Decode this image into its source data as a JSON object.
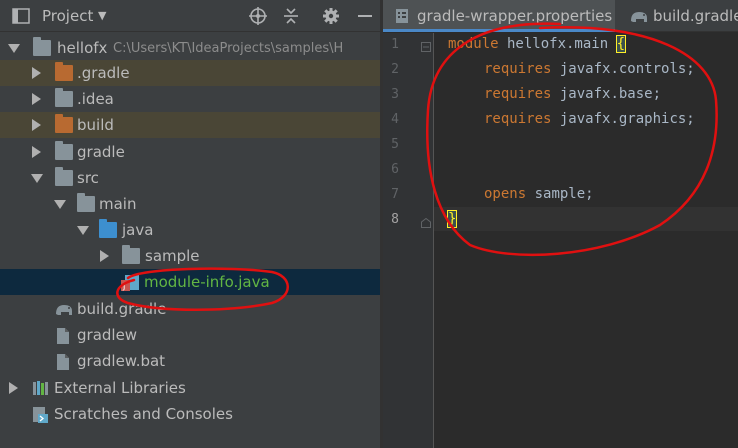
{
  "project_panel": {
    "title": "Project",
    "tree": [
      {
        "label": "hellofx",
        "path": "C:\\Users\\KT\\IdeaProjects\\samples\\H"
      },
      {
        "label": ".gradle"
      },
      {
        "label": ".idea"
      },
      {
        "label": "build"
      },
      {
        "label": "gradle"
      },
      {
        "label": "src"
      },
      {
        "label": "main"
      },
      {
        "label": "java"
      },
      {
        "label": "sample"
      },
      {
        "label": "module-info.java"
      },
      {
        "label": "build.gradle"
      },
      {
        "label": "gradlew"
      },
      {
        "label": "gradlew.bat"
      },
      {
        "label": "External Libraries"
      },
      {
        "label": "Scratches and Consoles"
      }
    ]
  },
  "editor": {
    "tabs": [
      {
        "label": "gradle-wrapper.properties"
      },
      {
        "label": "build.gradle"
      }
    ],
    "line_numbers": [
      "1",
      "2",
      "3",
      "4",
      "5",
      "6",
      "7",
      "8"
    ],
    "code": {
      "l1_kw": "module",
      "l1_name": " hellofx.main ",
      "l1_brace": "{",
      "l2_kw": "requires",
      "l2_name": " javafx.controls;",
      "l3_kw": "requires",
      "l3_name": " javafx.base;",
      "l4_kw": "requires",
      "l4_name": " javafx.graphics;",
      "l7_kw": "opens",
      "l7_name": " sample;",
      "l8_brace": "}"
    }
  },
  "colors": {
    "panel_bg": "#3c3f41",
    "editor_bg": "#2b2b2b",
    "keyword": "#cc7832",
    "selection": "#0d293e",
    "annotation": "#e01010"
  }
}
